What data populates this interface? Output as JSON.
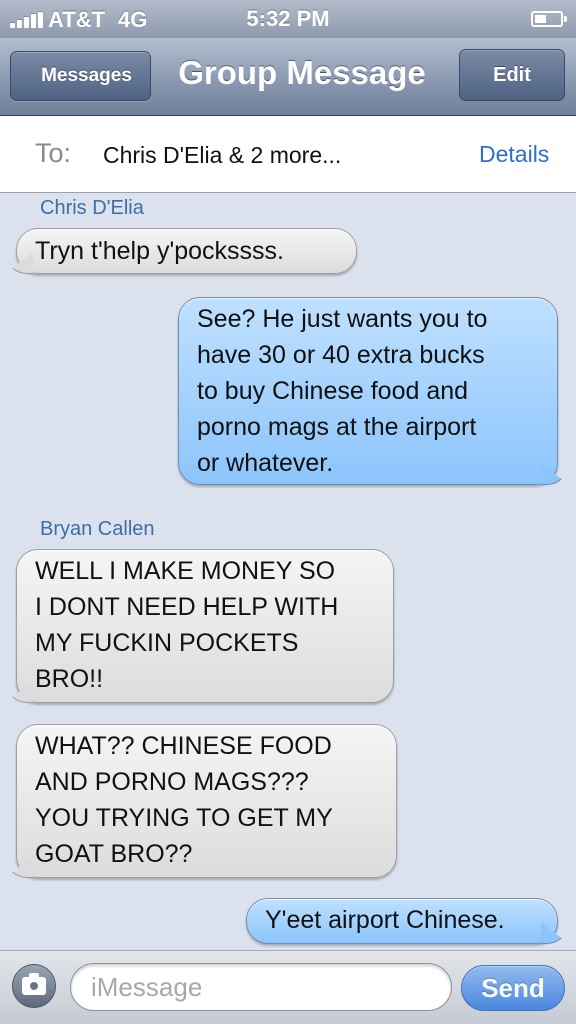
{
  "status_bar": {
    "carrier": "AT&T",
    "network": "4G",
    "time": "5:32 PM",
    "signal_bars": 5,
    "battery_level": 0.4
  },
  "nav_bar": {
    "back_label": "Messages",
    "title": "Group Message",
    "edit_label": "Edit"
  },
  "recipients": {
    "to_label": "To:",
    "value": "Chris D'Elia & 2 more...",
    "details_label": "Details"
  },
  "messages": [
    {
      "direction": "incoming",
      "sender": "Chris D'Elia",
      "lines": [
        "Tryn t'help y'pockssss."
      ]
    },
    {
      "direction": "outgoing",
      "lines": [
        "See? He just wants you to",
        "have 30 or 40 extra bucks",
        "to buy Chinese food and",
        "porno mags at the airport",
        "or whatever."
      ]
    },
    {
      "direction": "incoming",
      "sender": "Bryan Callen",
      "lines": [
        "WELL I MAKE MONEY SO",
        "I DONT NEED HELP WITH",
        "MY FUCKIN POCKETS",
        "BRO!!"
      ]
    },
    {
      "direction": "incoming",
      "lines": [
        "WHAT?? CHINESE FOOD",
        "AND PORNO MAGS???",
        "YOU TRYING TO GET MY",
        "GOAT BRO??"
      ]
    },
    {
      "direction": "outgoing",
      "lines": [
        "Y'eet airport Chinese."
      ]
    }
  ],
  "input_bar": {
    "camera_icon": "camera-icon",
    "placeholder": "iMessage",
    "send_label": "Send"
  },
  "colors": {
    "background": "#dbe2ed",
    "outgoing_bubble": "#8cc5fb",
    "incoming_bubble": "#dcdcdc",
    "link": "#2c6fcd",
    "sender_name": "#3d6ea8"
  }
}
